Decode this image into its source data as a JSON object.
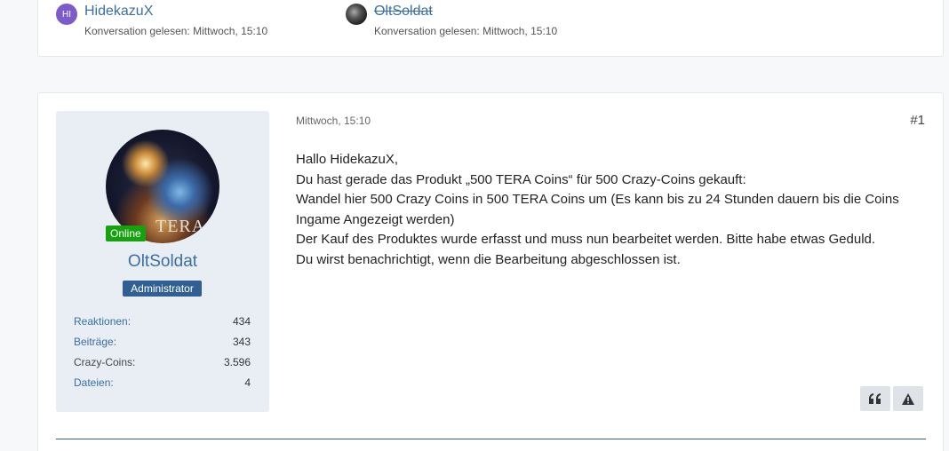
{
  "participants": [
    {
      "name": "HidekazuX",
      "initials": "HI",
      "status": "Konversation gelesen: Mittwoch, 15:10",
      "strikethrough": false
    },
    {
      "name": "OltSoldat",
      "initials": "",
      "status": "Konversation gelesen: Mittwoch, 15:10",
      "strikethrough": true
    }
  ],
  "post": {
    "date": "Mittwoch, 15:10",
    "number": "#1",
    "lines": [
      "Hallo HidekazuX,",
      "Du hast gerade das Produkt „500 TERA Coins“ für 500 Crazy-Coins gekauft:",
      "Wandel hier 500 Crazy Coins in 500 TERA Coins um (Es kann bis zu 24 Stunden dauern bis die Coins Ingame Angezeigt werden)",
      "Der Kauf des Produktes wurde erfasst und muss nun bearbeitet werden. Bitte habe etwas Geduld.",
      "Du wirst benachrichtigt, wenn die Bearbeitung abgeschlossen ist."
    ]
  },
  "author": {
    "name": "OltSoldat",
    "title": "Administrator",
    "online_label": "Online",
    "avatar_text": "TERA",
    "stats": [
      {
        "label": "Reaktionen:",
        "value": "434"
      },
      {
        "label": "Beiträge:",
        "value": "343"
      },
      {
        "label": "Crazy-Coins:",
        "value": "3.596"
      },
      {
        "label": "Dateien:",
        "value": "4"
      }
    ]
  },
  "colors": {
    "link": "#3a6fa5",
    "online": "#16a20f",
    "title_badge": "#2f5f93"
  },
  "icons": {
    "quote": "quote-icon",
    "report": "warning-icon"
  }
}
